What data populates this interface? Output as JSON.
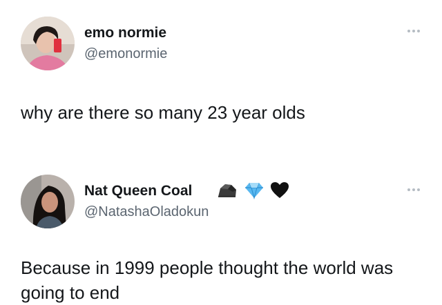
{
  "tweets": [
    {
      "display_name": "emo normie",
      "handle": "@emonormie",
      "text": "why are there so many 23 year olds",
      "avatar_icon": "profile-photo"
    },
    {
      "display_name": "Nat Queen Coal",
      "handle": "@NatashaOladokun",
      "text": "Because in 1999 people thought the world was going to end",
      "avatar_icon": "profile-photo",
      "badges": [
        "coal-emoji",
        "gem-emoji",
        "black-heart-emoji"
      ]
    }
  ],
  "colors": {
    "text": "#14171a",
    "secondary": "#5b6570",
    "more_dots": "#b5bcc3"
  }
}
